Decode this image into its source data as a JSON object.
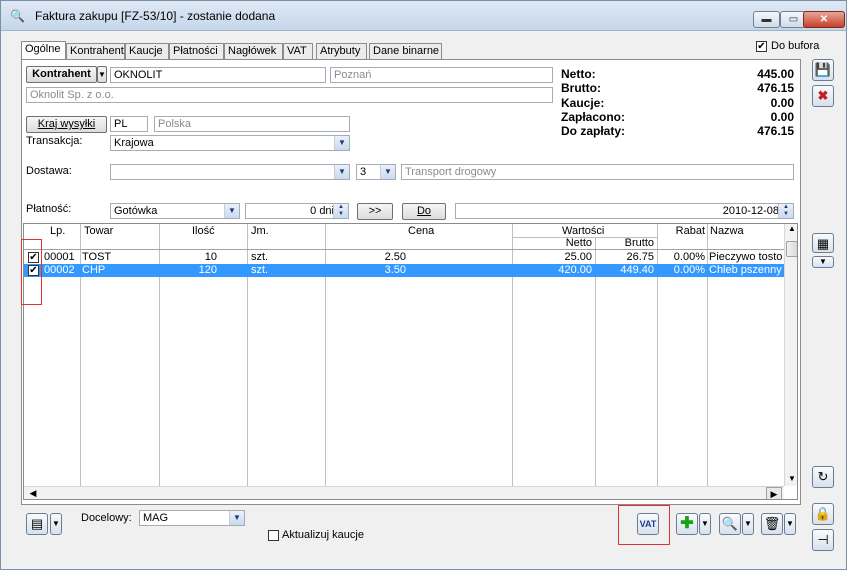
{
  "window": {
    "title": "Faktura zakupu [FZ-53/10]  - zostanie dodana",
    "app_icon": "invoice-icon"
  },
  "tabs": [
    "Ogólne",
    "Kontrahent",
    "Kaucje",
    "Płatności",
    "Nagłówek",
    "VAT",
    "Atrybuty",
    "Dane binarne"
  ],
  "do_bufora": {
    "label": "Do bufora",
    "checked": true
  },
  "kontrahent": {
    "button": "Kontrahent",
    "code": "OKNOLIT",
    "city": "Poznań",
    "name": "Oknolit Sp. z o.o."
  },
  "kraj": {
    "button": "Kraj wysyłki",
    "code": "PL",
    "name": "Polska"
  },
  "transakcja": {
    "label": "Transakcja:",
    "value": "Krajowa"
  },
  "dostawa": {
    "label": "Dostawa:",
    "value": "",
    "number": "3",
    "type": "Transport drogowy"
  },
  "platnosc": {
    "label": "Płatność:",
    "method": "Gotówka",
    "days": "0 dni",
    "next_btn": ">>",
    "do_btn": "Do",
    "date": "2010-12-08"
  },
  "summary": [
    {
      "label": "Netto:",
      "value": "445.00"
    },
    {
      "label": "Brutto:",
      "value": "476.15"
    },
    {
      "label": "Kaucje:",
      "value": "0.00"
    },
    {
      "label": "Zapłacono:",
      "value": "0.00"
    },
    {
      "label": "Do zapłaty:",
      "value": "476.15"
    }
  ],
  "table": {
    "headers": {
      "lp": "Lp.",
      "towar": "Towar",
      "ilosc": "Ilość",
      "jm": "Jm.",
      "cena": "Cena",
      "wartosci": "Wartości",
      "netto": "Netto",
      "brutto": "Brutto",
      "rabat": "Rabat",
      "nazwa": "Nazwa"
    },
    "rows": [
      {
        "checked": true,
        "lp": "00001",
        "towar": "TOST",
        "ilosc": "10",
        "jm": "szt.",
        "cena": "2.50",
        "netto": "25.00",
        "brutto": "26.75",
        "rabat": "0.00%",
        "nazwa": "Pieczywo tosto"
      },
      {
        "checked": true,
        "lp": "00002",
        "towar": "CHP",
        "ilosc": "120",
        "jm": "szt.",
        "cena": "3.50",
        "netto": "420.00",
        "brutto": "449.40",
        "rabat": "0.00%",
        "nazwa": "Chleb pszenny"
      }
    ]
  },
  "bottom": {
    "docelowy_label": "Docelowy:",
    "docelowy_value": "MAG",
    "aktualizuj_label": "Aktualizuj kaucje",
    "vat_btn": "VAT"
  },
  "colors": {
    "selection": "#3399ff",
    "highlight_box": "#e03030",
    "close_button": "#c7402a"
  }
}
